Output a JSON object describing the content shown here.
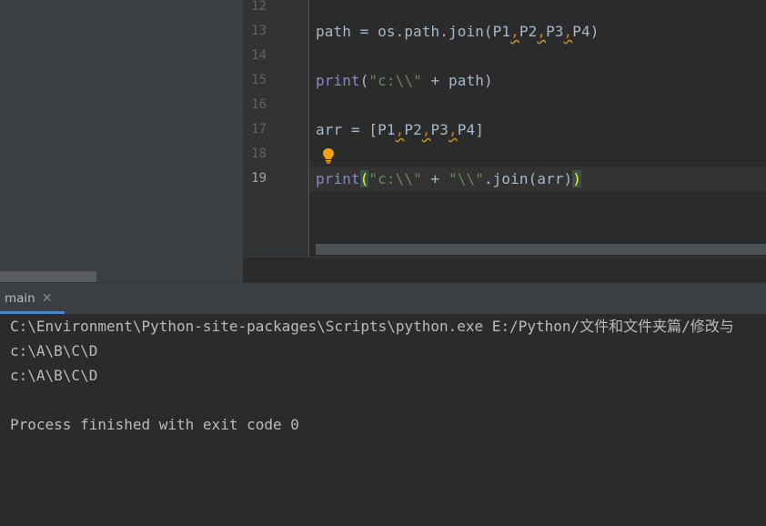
{
  "editor": {
    "lines": [
      {
        "num": "12",
        "code": []
      },
      {
        "num": "13",
        "code": [
          {
            "t": "path = os.path.join(P1",
            "c": "plain"
          },
          {
            "t": ",",
            "c": "comma"
          },
          {
            "t": "P2",
            "c": "plain"
          },
          {
            "t": ",",
            "c": "comma"
          },
          {
            "t": "P3",
            "c": "plain"
          },
          {
            "t": ",",
            "c": "comma"
          },
          {
            "t": "P4)",
            "c": "plain"
          }
        ]
      },
      {
        "num": "14",
        "code": []
      },
      {
        "num": "15",
        "code": [
          {
            "t": "print",
            "c": "builtin"
          },
          {
            "t": "(",
            "c": "plain"
          },
          {
            "t": "\"c:\\\\\"",
            "c": "string"
          },
          {
            "t": " + path)",
            "c": "plain"
          }
        ]
      },
      {
        "num": "16",
        "code": []
      },
      {
        "num": "17",
        "code": [
          {
            "t": "arr = [P1",
            "c": "plain"
          },
          {
            "t": ",",
            "c": "comma"
          },
          {
            "t": "P2",
            "c": "plain"
          },
          {
            "t": ",",
            "c": "comma"
          },
          {
            "t": "P3",
            "c": "plain"
          },
          {
            "t": ",",
            "c": "comma"
          },
          {
            "t": "P4]",
            "c": "plain"
          }
        ]
      },
      {
        "num": "18",
        "code": []
      },
      {
        "num": "19",
        "code": [
          {
            "t": "print",
            "c": "builtin"
          },
          {
            "t": "(",
            "c": "brace"
          },
          {
            "t": "\"c:\\\\\"",
            "c": "string"
          },
          {
            "t": " + ",
            "c": "plain"
          },
          {
            "t": "\"\\\\\"",
            "c": "string"
          },
          {
            "t": ".join(arr)",
            "c": "plain"
          },
          {
            "t": ")",
            "c": "brace"
          }
        ]
      }
    ],
    "active_line": "19",
    "intention_icon": "lightbulb-icon"
  },
  "run": {
    "tab_label": "main",
    "close_icon": "close-icon",
    "output": [
      "C:\\Environment\\Python-site-packages\\Scripts\\python.exe E:/Python/文件和文件夹篇/修改与",
      "c:\\A\\B\\C\\D",
      "c:\\A\\B\\C\\D",
      "",
      "Process finished with exit code 0"
    ]
  },
  "colors": {
    "background": "#2b2b2b",
    "panel": "#3c3f41",
    "builtin": "#8888c6",
    "string": "#6a8759",
    "comma": "#cc7832",
    "tab_underline": "#4a88c7",
    "bulb": "#f0a30a"
  }
}
